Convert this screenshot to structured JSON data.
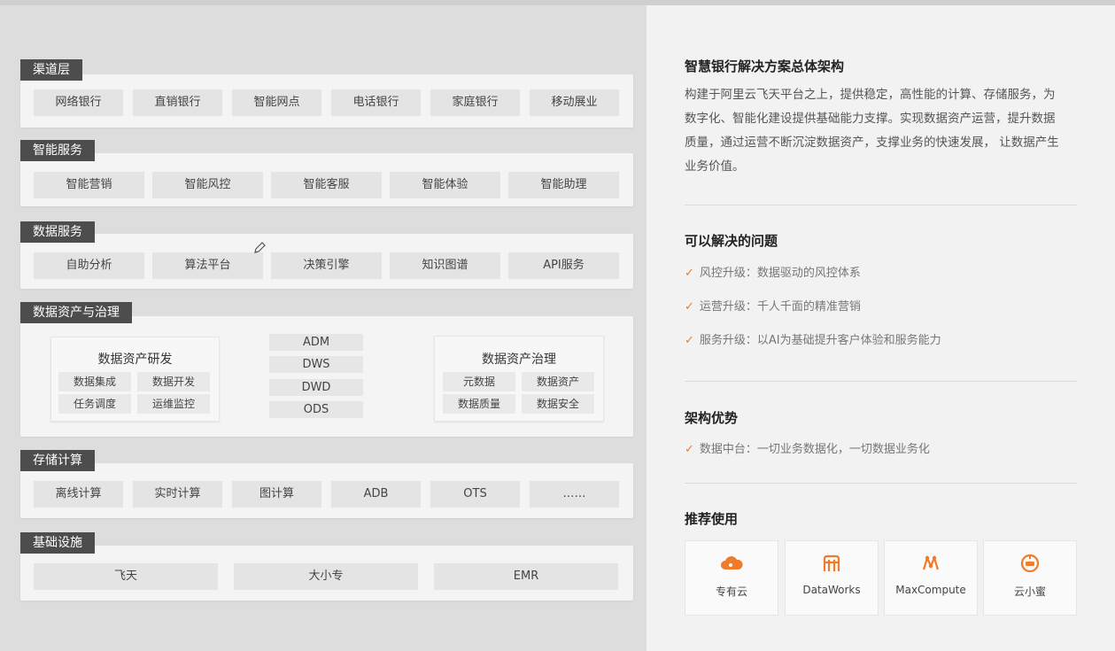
{
  "architecture": {
    "layers": [
      {
        "label": "渠道层",
        "items": [
          "网络银行",
          "直销银行",
          "智能网点",
          "电话银行",
          "家庭银行",
          "移动展业"
        ]
      },
      {
        "label": "智能服务",
        "items": [
          "智能营销",
          "智能风控",
          "智能客服",
          "智能体验",
          "智能助理"
        ]
      },
      {
        "label": "数据服务",
        "items": [
          "自助分析",
          "算法平台",
          "决策引擎",
          "知识图谱",
          "API服务"
        ]
      },
      {
        "label": "数据资产与治理",
        "dev": {
          "title": "数据资产研发",
          "items": [
            "数据集成",
            "数据开发",
            "任务调度",
            "运维监控"
          ]
        },
        "stack": [
          "ADM",
          "DWS",
          "DWD",
          "ODS"
        ],
        "gov": {
          "title": "数据资产治理",
          "items": [
            "元数据",
            "数据资产",
            "数据质量",
            "数据安全"
          ]
        }
      },
      {
        "label": "存储计算",
        "items": [
          "离线计算",
          "实时计算",
          "图计算",
          "ADB",
          "OTS",
          "……"
        ]
      },
      {
        "label": "基础设施",
        "items": [
          "飞天",
          "大小专",
          "EMR"
        ]
      }
    ]
  },
  "info": {
    "title": "智慧银行解决方案总体架构",
    "description": "构建于阿里云飞天平台之上，提供稳定，高性能的计算、存储服务，为数字化、智能化建设提供基础能力支撑。实现数据资产运营，提升数据质量，通过运营不断沉淀数据资产，支撑业务的快速发展， 让数据产生业务价值。",
    "problems_title": "可以解决的问题",
    "problems": [
      "风控升级：数据驱动的风控体系",
      "运营升级：千人千面的精准营销",
      "服务升级：以AI为基础提升客户体验和服务能力"
    ],
    "advantages_title": "架构优势",
    "advantages": [
      "数据中台：一切业务数据化，一切数据业务化"
    ],
    "recommend_title": "推荐使用",
    "products": [
      {
        "name": "专有云",
        "icon": "cloud-icon"
      },
      {
        "name": "DataWorks",
        "icon": "dataworks-icon"
      },
      {
        "name": "MaxCompute",
        "icon": "maxcompute-icon"
      },
      {
        "name": "云小蜜",
        "icon": "robot-icon"
      }
    ],
    "accent_color": "#f07b2a",
    "check_icon": "check-icon"
  }
}
